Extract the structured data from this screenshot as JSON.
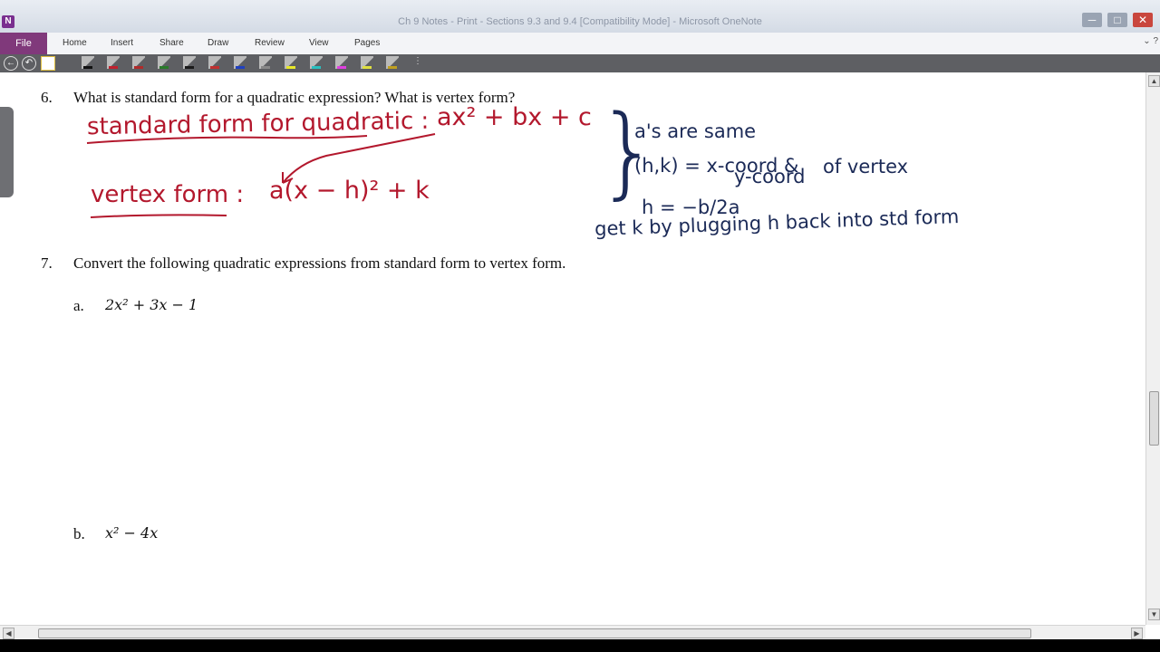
{
  "window": {
    "app_icon": "N",
    "title": "Ch 9 Notes - Print - Sections 9.3 and 9.4 [Compatibility Mode] - Microsoft OneNote",
    "controls": [
      "─",
      "□",
      "✕"
    ]
  },
  "ribbon": {
    "file_label": "File",
    "tabs": [
      "Home",
      "Insert",
      "Share",
      "Draw",
      "Review",
      "View",
      "Pages"
    ]
  },
  "toolbar": {
    "pen_colors": [
      "#111111",
      "#c0202d",
      "#b02a2a",
      "#2a7a2a",
      "#1a1a1a",
      "#c03030",
      "#2040c0",
      "#888888",
      "#e8e82a",
      "#2ac0c0",
      "#e040e0",
      "#e0e040",
      "#c0a020"
    ]
  },
  "questions": [
    {
      "number": "6.",
      "text": "What is standard form for a quadratic expression?  What is vertex form?"
    },
    {
      "number": "7.",
      "text": "Convert the following quadratic expressions from standard form to vertex form."
    }
  ],
  "parts": [
    {
      "label": "a.",
      "expr": "2x² + 3x − 1"
    },
    {
      "label": "b.",
      "expr": "x² − 4x"
    }
  ],
  "ink": {
    "red": {
      "standard_label": "standard form for quadratic :",
      "standard_expr": "ax² + bx + c",
      "vertex_label": "vertex form :",
      "vertex_expr": "a(x − h)² + k"
    },
    "blue": {
      "brace": "}",
      "line1": "a's are same",
      "line2a": "(h,k) = x-coord &",
      "line2b": "y-coord",
      "line2c": "of vertex",
      "line3": "h = −b/2a",
      "line4": "get k by plugging h back into std form"
    }
  },
  "scrollbars": {
    "up": "▲",
    "down": "▼",
    "left": "◀",
    "right": "▶"
  }
}
